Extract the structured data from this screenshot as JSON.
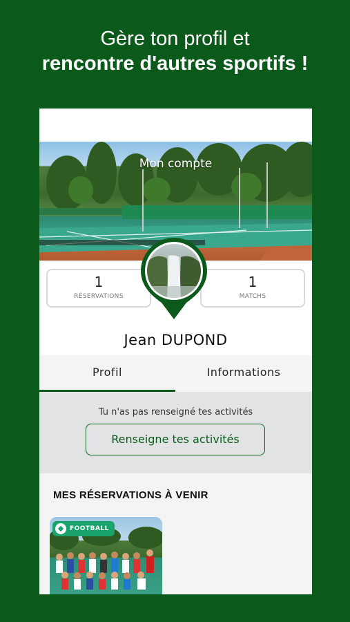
{
  "headline": {
    "line1": "Gère ton profil et",
    "line2": "rencontre d'autres sportifs !"
  },
  "cover": {
    "title": "Mon compte"
  },
  "stats": {
    "reservations": {
      "value": "1",
      "label": "RÉSERVATIONS"
    },
    "matchs": {
      "value": "1",
      "label": "MATCHS"
    }
  },
  "user": {
    "name": "Jean  DUPOND"
  },
  "tabs": [
    {
      "label": "Profil",
      "active": true
    },
    {
      "label": "Informations",
      "active": false
    }
  ],
  "activities": {
    "message": "Tu n'as pas renseigné tes activités",
    "button_label": "Renseigne tes activités"
  },
  "upcoming": {
    "title": "MES RÉSERVATIONS À VENIR",
    "cards": [
      {
        "badge": "FOOTBALL",
        "icon": "football-icon"
      }
    ]
  },
  "colors": {
    "brand_green": "#0b5a1c",
    "badge_green": "#1aa36a"
  }
}
